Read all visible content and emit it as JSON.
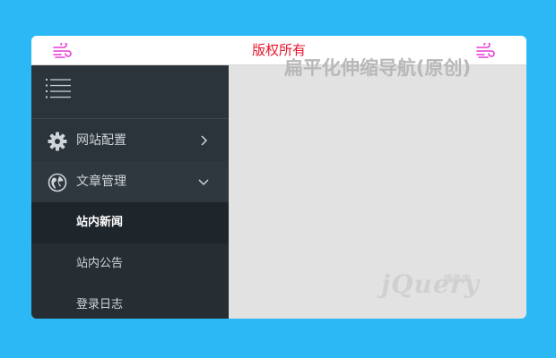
{
  "header": {
    "title": "版权所有"
  },
  "sidebar": {
    "items": [
      {
        "label": "网站配置"
      },
      {
        "label": "文章管理"
      }
    ],
    "subitems": [
      {
        "label": "站内新闻"
      },
      {
        "label": "站内公告"
      },
      {
        "label": "登录日志"
      }
    ]
  },
  "main": {
    "headline": "扁平化伸缩导航(原创)"
  },
  "watermark": {
    "brand": "jQuery",
    "brand_cn": "插件库"
  },
  "colors": {
    "page_background": "#2bb8f5",
    "title_red": "#e8152d",
    "icon_magenta": "#e63ad6",
    "sidebar_dark": "#2b343b"
  }
}
